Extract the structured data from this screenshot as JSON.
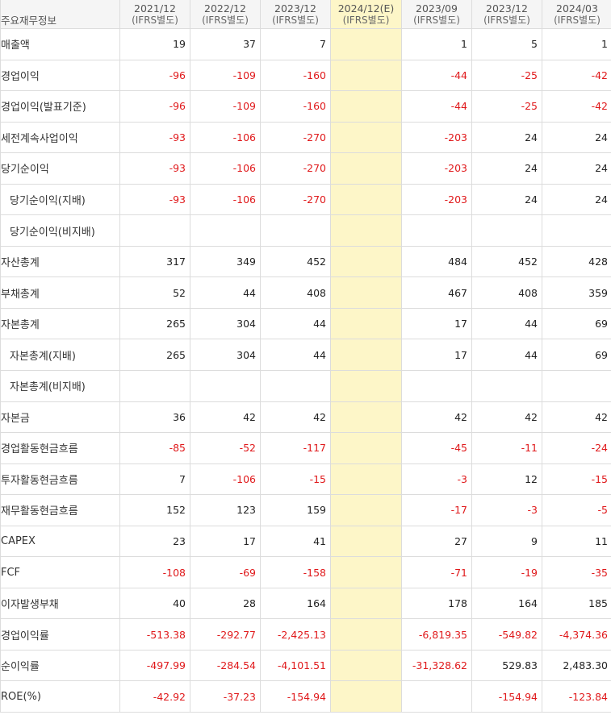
{
  "header": {
    "corner": "주요재무정보",
    "columns": [
      {
        "period": "2021/12",
        "basis": "(IFRS별도)"
      },
      {
        "period": "2022/12",
        "basis": "(IFRS별도)"
      },
      {
        "period": "2023/12",
        "basis": "(IFRS별도)"
      },
      {
        "period": "2024/12(E)",
        "basis": "(IFRS별도)"
      },
      {
        "period": "2023/09",
        "basis": "(IFRS별도)"
      },
      {
        "period": "2023/12",
        "basis": "(IFRS별도)"
      },
      {
        "period": "2024/03",
        "basis": "(IFRS별도)"
      }
    ]
  },
  "rows": [
    {
      "label": "매출액",
      "values": [
        "19",
        "37",
        "7",
        "",
        "1",
        "5",
        "1"
      ]
    },
    {
      "label": "경업이익",
      "values": [
        "-96",
        "-109",
        "-160",
        "",
        "-44",
        "-25",
        "-42"
      ]
    },
    {
      "label": "경업이익(발표기준)",
      "values": [
        "-96",
        "-109",
        "-160",
        "",
        "-44",
        "-25",
        "-42"
      ]
    },
    {
      "label": "세전계속사업이익",
      "values": [
        "-93",
        "-106",
        "-270",
        "",
        "-203",
        "24",
        "24"
      ]
    },
    {
      "label": "당기순이익",
      "values": [
        "-93",
        "-106",
        "-270",
        "",
        "-203",
        "24",
        "24"
      ]
    },
    {
      "label": "당기순이익(지배)",
      "values": [
        "-93",
        "-106",
        "-270",
        "",
        "-203",
        "24",
        "24"
      ]
    },
    {
      "label": "당기순이익(비지배)",
      "values": [
        "",
        "",
        "",
        "",
        "",
        "",
        ""
      ]
    },
    {
      "label": "자산총계",
      "values": [
        "317",
        "349",
        "452",
        "",
        "484",
        "452",
        "428"
      ]
    },
    {
      "label": "부채총계",
      "values": [
        "52",
        "44",
        "408",
        "",
        "467",
        "408",
        "359"
      ]
    },
    {
      "label": "자본총계",
      "values": [
        "265",
        "304",
        "44",
        "",
        "17",
        "44",
        "69"
      ]
    },
    {
      "label": "자본총계(지배)",
      "values": [
        "265",
        "304",
        "44",
        "",
        "17",
        "44",
        "69"
      ]
    },
    {
      "label": "자본총계(비지배)",
      "values": [
        "",
        "",
        "",
        "",
        "",
        "",
        ""
      ]
    },
    {
      "label": "자본금",
      "values": [
        "36",
        "42",
        "42",
        "",
        "42",
        "42",
        "42"
      ]
    },
    {
      "label": "경업활동현금흐름",
      "values": [
        "-85",
        "-52",
        "-117",
        "",
        "-45",
        "-11",
        "-24"
      ]
    },
    {
      "label": "투자활동현금흐름",
      "values": [
        "7",
        "-106",
        "-15",
        "",
        "-3",
        "12",
        "-15"
      ]
    },
    {
      "label": "재무활동현금흐름",
      "values": [
        "152",
        "123",
        "159",
        "",
        "-17",
        "-3",
        "-5"
      ]
    },
    {
      "label": "CAPEX",
      "values": [
        "23",
        "17",
        "41",
        "",
        "27",
        "9",
        "11"
      ]
    },
    {
      "label": "FCF",
      "values": [
        "-108",
        "-69",
        "-158",
        "",
        "-71",
        "-19",
        "-35"
      ]
    },
    {
      "label": "이자발생부채",
      "values": [
        "40",
        "28",
        "164",
        "",
        "178",
        "164",
        "185"
      ]
    },
    {
      "label": "경업이익률",
      "values": [
        "-513.38",
        "-292.77",
        "-2,425.13",
        "",
        "-6,819.35",
        "-549.82",
        "-4,374.36"
      ]
    },
    {
      "label": "순이익률",
      "values": [
        "-497.99",
        "-284.54",
        "-4,101.51",
        "",
        "-31,328.62",
        "529.83",
        "2,483.30"
      ]
    },
    {
      "label": "ROE(%)",
      "values": [
        "-42.92",
        "-37.23",
        "-154.94",
        "",
        "",
        "-154.94",
        "-123.84"
      ]
    }
  ],
  "colors": {
    "negative": "#e0191b",
    "estimate_bg": "#fdf6c8",
    "header_bg": "#f5f5f5"
  }
}
